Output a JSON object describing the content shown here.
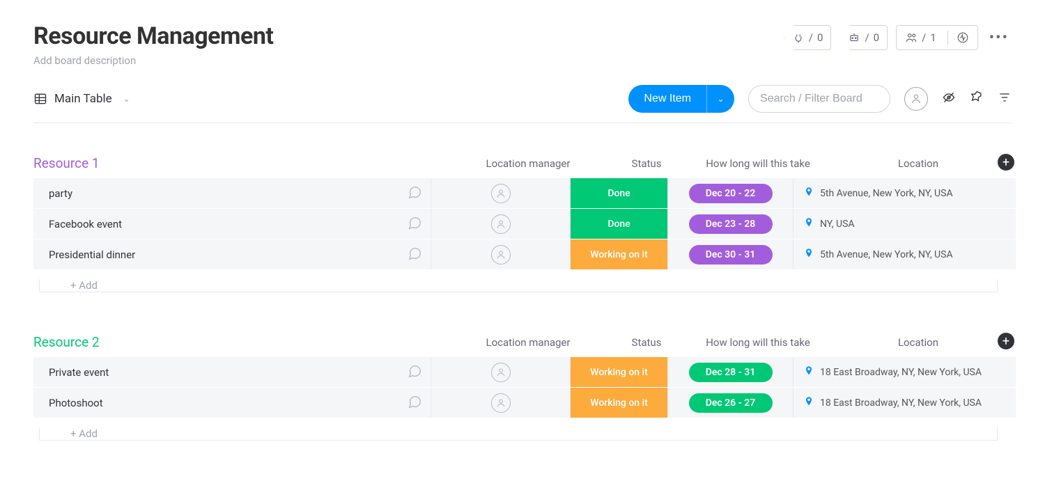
{
  "header": {
    "title": "Resource Management",
    "description_placeholder": "Add board description",
    "integrations_count": "0",
    "automations_count": "0",
    "members_count": "1"
  },
  "toolbar": {
    "view_label": "Main Table",
    "new_item_label": "New Item",
    "search_placeholder": "Search / Filter Board"
  },
  "columns": {
    "manager": "Location manager",
    "status": "Status",
    "timeline": "How long will this take",
    "location": "Location"
  },
  "add_row_label": "+ Add",
  "status_labels": {
    "done": "Done",
    "working": "Working on it"
  },
  "groups": [
    {
      "name": "Resource 1",
      "color": "#a25ddc",
      "items": [
        {
          "name": "party",
          "status": "done",
          "status_color": "#00c875",
          "timeline": "Dec 20 - 22",
          "time_color": "#a25ddc",
          "location": "5th Avenue, New York, NY, USA"
        },
        {
          "name": "Facebook event",
          "status": "done",
          "status_color": "#00c875",
          "timeline": "Dec 23 - 28",
          "time_color": "#a25ddc",
          "location": "NY, USA"
        },
        {
          "name": "Presidential dinner",
          "status": "working",
          "status_color": "#fdab3d",
          "timeline": "Dec 30 - 31",
          "time_color": "#a25ddc",
          "location": "5th Avenue, New York, NY, USA"
        }
      ]
    },
    {
      "name": "Resource 2",
      "color": "#00c875",
      "items": [
        {
          "name": "Private event",
          "status": "working",
          "status_color": "#fdab3d",
          "timeline": "Dec 28 - 31",
          "time_color": "#00c875",
          "location": "18 East Broadway, NY, New York, USA"
        },
        {
          "name": "Photoshoot",
          "status": "working",
          "status_color": "#fdab3d",
          "timeline": "Dec 26 - 27",
          "time_color": "#00c875",
          "location": "18 East Broadway, NY, New York, USA"
        }
      ]
    }
  ]
}
